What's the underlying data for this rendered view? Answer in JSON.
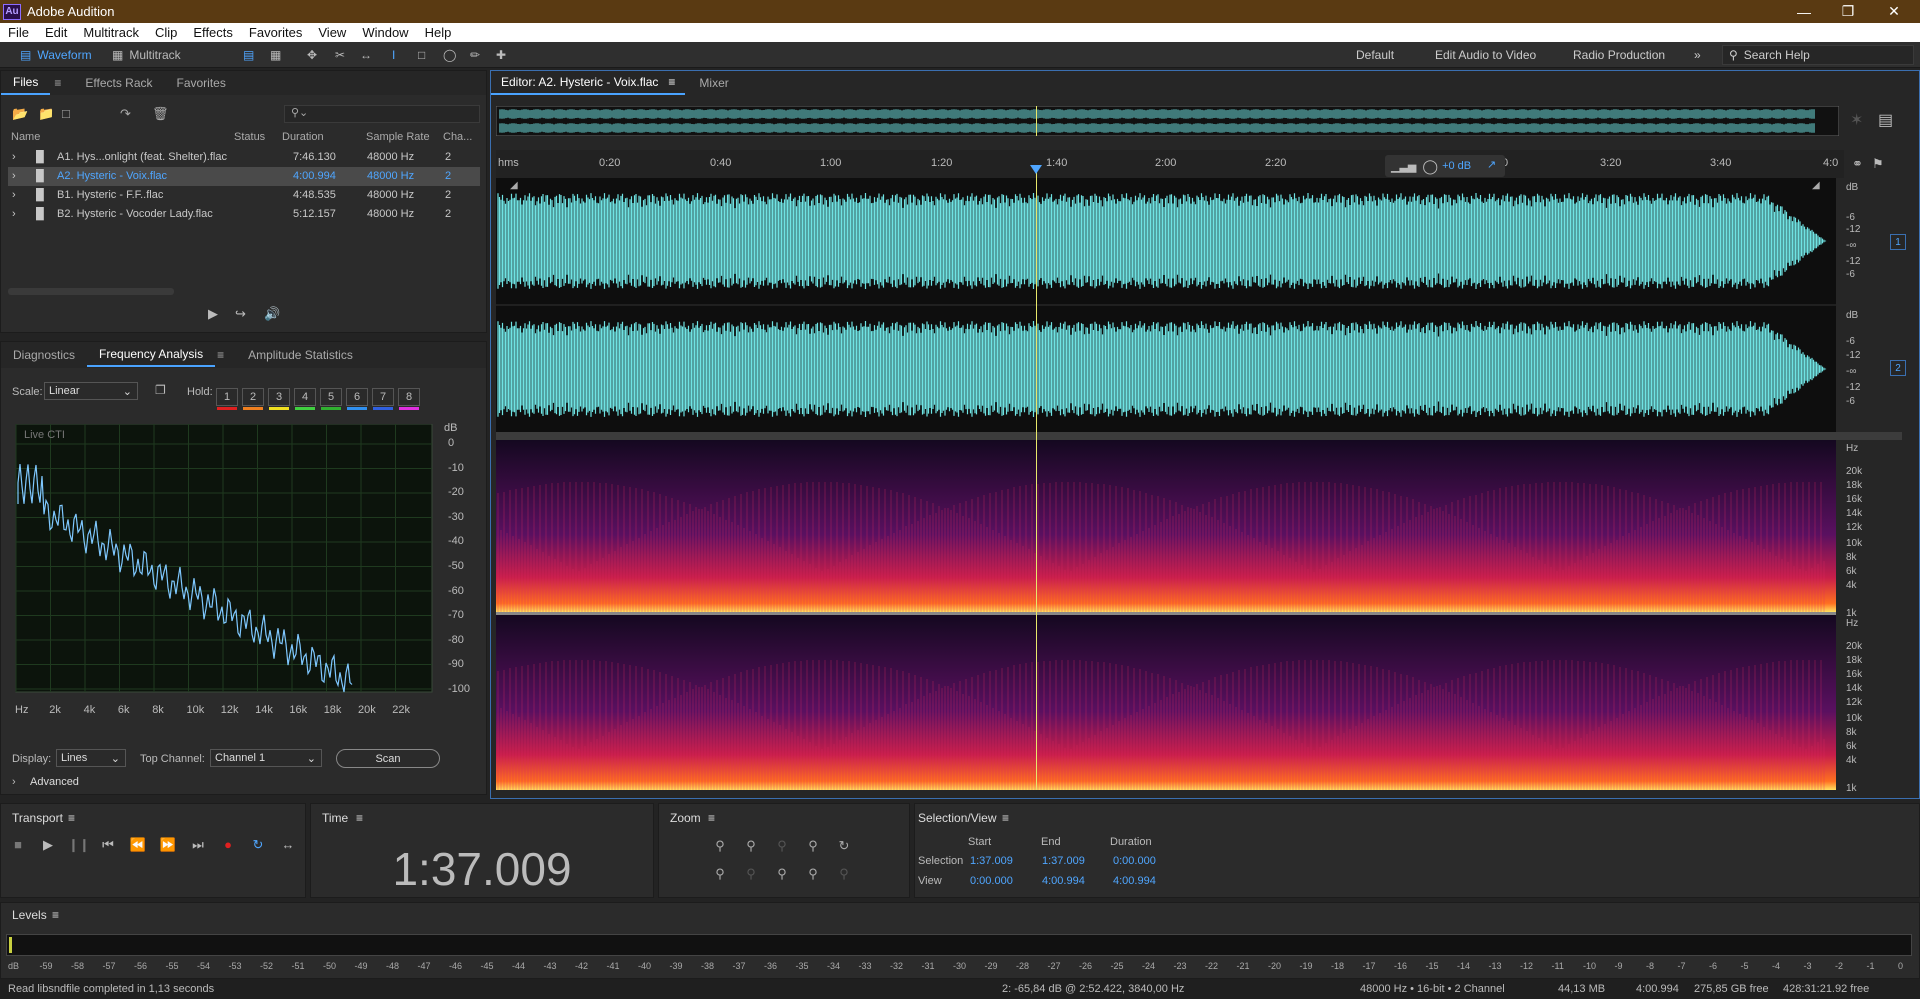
{
  "app": {
    "title": "Adobe Audition",
    "logo": "Au"
  },
  "menu": [
    "File",
    "Edit",
    "Multitrack",
    "Clip",
    "Effects",
    "Favorites",
    "View",
    "Window",
    "Help"
  ],
  "toolbar": {
    "waveform": "Waveform",
    "multitrack": "Multitrack"
  },
  "workspaces": [
    "Default",
    "Edit Audio to Video",
    "Radio Production"
  ],
  "search": {
    "placeholder": "Search Help"
  },
  "files_panel": {
    "tabs": [
      "Files",
      "Effects Rack",
      "Favorites"
    ],
    "columns": [
      "Name",
      "Status",
      "Duration",
      "Sample Rate",
      "Cha..."
    ],
    "rows": [
      {
        "name": "A1. Hys...onlight (feat. Shelter).flac",
        "duration": "7:46.130",
        "rate": "48000 Hz",
        "ch": "2",
        "selected": false
      },
      {
        "name": "A2. Hysteric - Voix.flac",
        "duration": "4:00.994",
        "rate": "48000 Hz",
        "ch": "2",
        "selected": true
      },
      {
        "name": "B1. Hysteric - F.F..flac",
        "duration": "4:48.535",
        "rate": "48000 Hz",
        "ch": "2",
        "selected": false
      },
      {
        "name": "B2. Hysteric - Vocoder Lady.flac",
        "duration": "5:12.157",
        "rate": "48000 Hz",
        "ch": "2",
        "selected": false
      }
    ]
  },
  "analysis_panel": {
    "tabs": [
      "Diagnostics",
      "Frequency Analysis",
      "Amplitude Statistics"
    ],
    "scale_label": "Scale:",
    "scale_value": "Linear",
    "hold_label": "Hold:",
    "hold": [
      "1",
      "2",
      "3",
      "4",
      "5",
      "6",
      "7",
      "8"
    ],
    "hold_colors": [
      "#e02020",
      "#f08020",
      "#f0e020",
      "#40d040",
      "#30b030",
      "#3090f0",
      "#3060e0",
      "#e030e0"
    ],
    "graph_label": "Live CTI",
    "db_unit": "dB",
    "db_ticks": [
      "0",
      "-10",
      "-20",
      "-30",
      "-40",
      "-50",
      "-60",
      "-70",
      "-80",
      "-90",
      "-100"
    ],
    "freq_ticks": [
      "Hz",
      "2k",
      "4k",
      "6k",
      "8k",
      "10k",
      "12k",
      "14k",
      "16k",
      "18k",
      "20k",
      "22k"
    ],
    "display_label": "Display:",
    "display_value": "Lines",
    "top_channel_label": "Top Channel:",
    "top_channel_value": "Channel 1",
    "scan": "Scan",
    "advanced": "Advanced"
  },
  "editor": {
    "tabs": [
      "Editor: A2. Hysteric - Voix.flac",
      "Mixer"
    ],
    "timeline": [
      "hms",
      "0:20",
      "0:40",
      "1:00",
      "1:20",
      "1:40",
      "2:00",
      "2:20",
      "0",
      "3:20",
      "3:40",
      "4:0"
    ],
    "gain": "+0 dB",
    "db_ticks_ch": [
      "dB",
      "-6",
      "-12",
      "-∞",
      "-12",
      "-6"
    ],
    "hz_ticks": [
      "Hz",
      "20k",
      "18k",
      "16k",
      "14k",
      "12k",
      "10k",
      "8k",
      "6k",
      "4k",
      "1k"
    ],
    "channels": [
      "1",
      "2"
    ]
  },
  "transport": {
    "title": "Transport"
  },
  "time": {
    "title": "Time",
    "value": "1:37.009"
  },
  "zoom": {
    "title": "Zoom"
  },
  "selection": {
    "title": "Selection/View",
    "headers": [
      "Start",
      "End",
      "Duration"
    ],
    "rows": [
      {
        "label": "Selection",
        "start": "1:37.009",
        "end": "1:37.009",
        "duration": "0:00.000"
      },
      {
        "label": "View",
        "start": "0:00.000",
        "end": "4:00.994",
        "duration": "4:00.994"
      }
    ]
  },
  "levels": {
    "title": "Levels",
    "ticks": [
      "dB",
      "-59",
      "-58",
      "-57",
      "-56",
      "-55",
      "-54",
      "-53",
      "-52",
      "-51",
      "-50",
      "-49",
      "-48",
      "-47",
      "-46",
      "-45",
      "-44",
      "-43",
      "-42",
      "-41",
      "-40",
      "-39",
      "-38",
      "-37",
      "-36",
      "-35",
      "-34",
      "-33",
      "-32",
      "-31",
      "-30",
      "-29",
      "-28",
      "-27",
      "-26",
      "-25",
      "-24",
      "-23",
      "-22",
      "-21",
      "-20",
      "-19",
      "-18",
      "-17",
      "-16",
      "-15",
      "-14",
      "-13",
      "-12",
      "-11",
      "-10",
      "-9",
      "-8",
      "-7",
      "-6",
      "-5",
      "-4",
      "-3",
      "-2",
      "-1",
      "0"
    ]
  },
  "status": {
    "left": "Read libsndfile completed in 1,13 seconds",
    "cursor": "2: -65,84 dB @ 2:52.422, 3840,00 Hz",
    "format": "48000 Hz • 16-bit • 2 Channel",
    "size": "44,13 MB",
    "duration": "4:00.994",
    "free": "275,85 GB free",
    "time_free": "428:31:21.92 free"
  },
  "colors": {
    "waveform": "#6fe3e3",
    "accent": "#4fa6ff",
    "playhead": "#e8e86a"
  }
}
